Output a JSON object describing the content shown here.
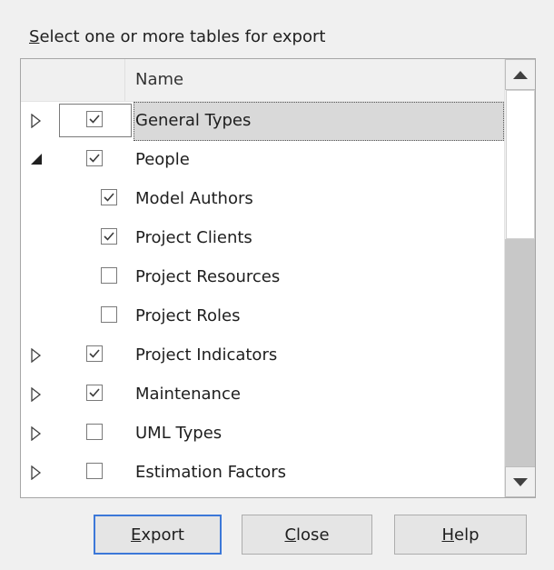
{
  "prompt": {
    "mnemonic": "S",
    "rest": "elect one or more tables for export"
  },
  "tree": {
    "header": {
      "name": "Name"
    },
    "rows": [
      {
        "label": "General Types",
        "expander": "collapsed",
        "checked": true,
        "indent": 0,
        "selected": true
      },
      {
        "label": "People",
        "expander": "expanded",
        "checked": true,
        "indent": 0,
        "selected": false
      },
      {
        "label": "Model Authors",
        "expander": "none",
        "checked": true,
        "indent": 1,
        "selected": false
      },
      {
        "label": "Project Clients",
        "expander": "none",
        "checked": true,
        "indent": 1,
        "selected": false
      },
      {
        "label": "Project Resources",
        "expander": "none",
        "checked": false,
        "indent": 1,
        "selected": false
      },
      {
        "label": "Project Roles",
        "expander": "none",
        "checked": false,
        "indent": 1,
        "selected": false
      },
      {
        "label": "Project Indicators",
        "expander": "collapsed",
        "checked": true,
        "indent": 0,
        "selected": false
      },
      {
        "label": "Maintenance",
        "expander": "collapsed",
        "checked": true,
        "indent": 0,
        "selected": false
      },
      {
        "label": "UML Types",
        "expander": "collapsed",
        "checked": false,
        "indent": 0,
        "selected": false
      },
      {
        "label": "Estimation Factors",
        "expander": "collapsed",
        "checked": false,
        "indent": 0,
        "selected": false
      }
    ]
  },
  "buttons": {
    "export": {
      "mnemonic": "E",
      "rest": "xport"
    },
    "close": {
      "mnemonic": "C",
      "rest": "lose"
    },
    "help": {
      "mnemonic": "H",
      "rest": "elp"
    }
  },
  "colors": {
    "default_button_border": "#3c78d8",
    "selection": "#d9d9d9"
  },
  "icons": {
    "collapsed": "triangle-right-outline-icon",
    "expanded": "triangle-down-filled-icon",
    "scroll_up": "scroll-up-icon",
    "scroll_down": "scroll-down-icon",
    "check": "checkmark-icon"
  }
}
